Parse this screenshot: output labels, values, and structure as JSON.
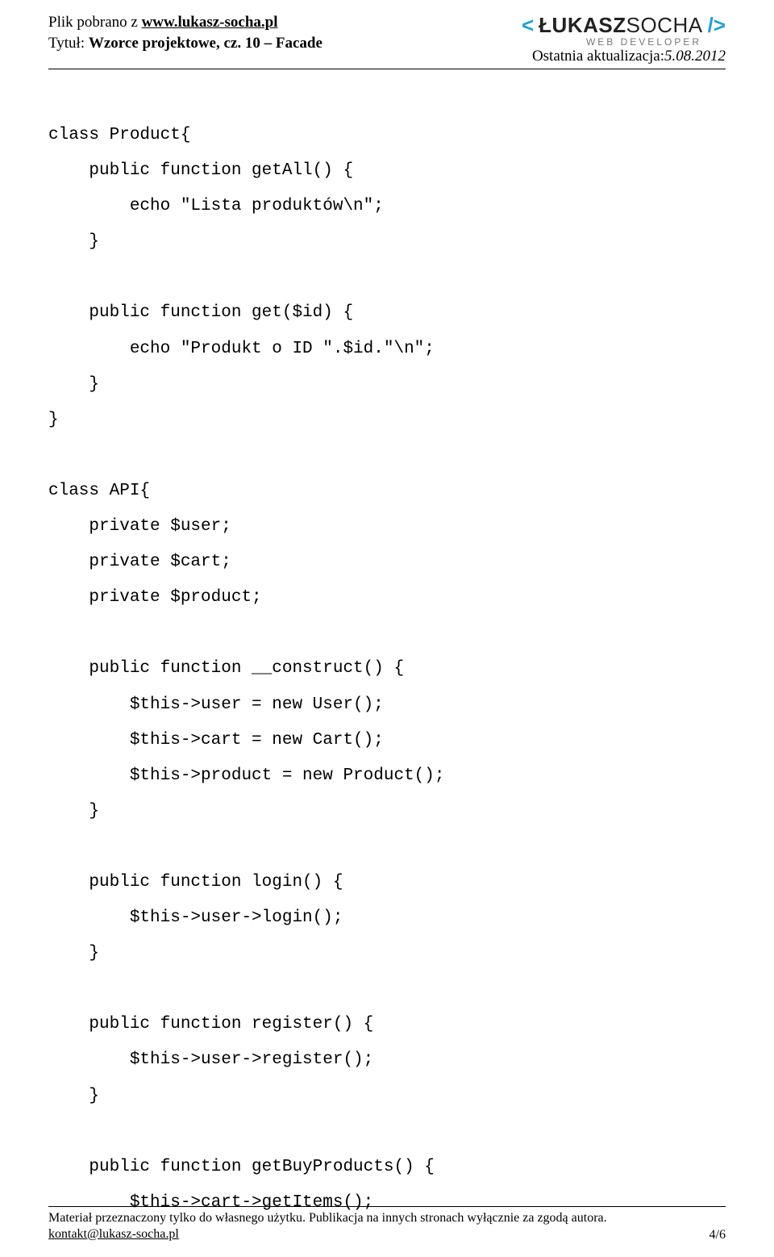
{
  "header": {
    "left": {
      "line1_prefix": "Plik pobrano z ",
      "line1_link": "www.lukasz-socha.pl",
      "line2_prefix": "Tytuł: ",
      "line2_title": "Wzorce projektowe, cz. 10 – Facade"
    },
    "right": {
      "logo_bracket_open": "<",
      "logo_name1": "ŁUKASZ",
      "logo_name2": "SOCHA",
      "logo_bracket_close": "/>",
      "logo_sub": "WEB DEVELOPER",
      "updated_label": "Ostatnia aktualizacja:",
      "updated_date": "5.08.2012"
    }
  },
  "code": "class Product{\n    public function getAll() {\n        echo \"Lista produktów\\n\";\n    }\n\n    public function get($id) {\n        echo \"Produkt o ID \".$id.\"\\n\";\n    }\n}\n\nclass API{\n    private $user;\n    private $cart;\n    private $product;\n\n    public function __construct() {\n        $this->user = new User();\n        $this->cart = new Cart();\n        $this->product = new Product();\n    }\n\n    public function login() {\n        $this->user->login();\n    }\n\n    public function register() {\n        $this->user->register();\n    }\n\n    public function getBuyProducts() {\n        $this->cart->getItems();",
  "footer": {
    "disclaimer": "Materiał przeznaczony tylko do własnego użytku. Publikacja na innych stronach wyłącznie za zgodą autora.",
    "contact": "kontakt@lukasz-socha.pl",
    "page": "4/6"
  }
}
